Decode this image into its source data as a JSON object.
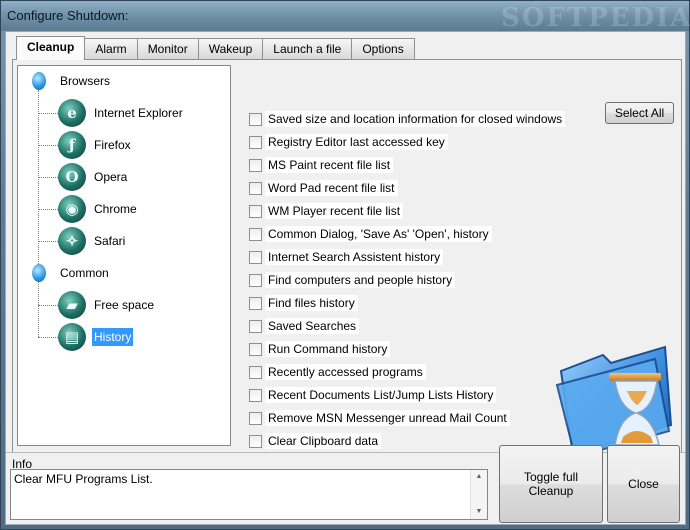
{
  "window": {
    "title": "Configure Shutdown:",
    "watermark": "SOFTPEDIA"
  },
  "tabs": [
    {
      "label": "Cleanup",
      "active": true
    },
    {
      "label": "Alarm",
      "active": false
    },
    {
      "label": "Monitor",
      "active": false
    },
    {
      "label": "Wakeup",
      "active": false
    },
    {
      "label": "Launch a file",
      "active": false
    },
    {
      "label": "Options",
      "active": false
    }
  ],
  "tree": {
    "groups": [
      {
        "label": "Browsers",
        "items": [
          {
            "label": "Internet Explorer",
            "icon": "internet-explorer-icon",
            "glyph": "e"
          },
          {
            "label": "Firefox",
            "icon": "firefox-icon",
            "glyph": "ƒ"
          },
          {
            "label": "Opera",
            "icon": "opera-icon",
            "glyph": "O"
          },
          {
            "label": "Chrome",
            "icon": "chrome-icon",
            "glyph": "◉"
          },
          {
            "label": "Safari",
            "icon": "safari-icon",
            "glyph": "✧"
          }
        ]
      },
      {
        "label": "Common",
        "items": [
          {
            "label": "Free space",
            "icon": "free-space-icon",
            "glyph": "▰"
          },
          {
            "label": "History",
            "icon": "history-icon",
            "glyph": "▤",
            "selected": true
          }
        ]
      }
    ]
  },
  "select_all_label": "Select All",
  "checklist": [
    "Saved size and location information for closed windows",
    "Registry Editor last accessed key",
    "MS Paint recent file list",
    "Word Pad recent file list",
    "WM Player recent file list",
    "Common Dialog, 'Save As' 'Open', history",
    "Internet Search Assistent history",
    "Find computers and people history",
    "Find files history",
    "Saved Searches",
    "Run Command history",
    "Recently accessed programs",
    "Recent Documents List/Jump Lists History",
    "Remove MSN Messenger unread Mail Count",
    "Clear Clipboard data"
  ],
  "info": {
    "label": "Info",
    "text": "Clear MFU Programs List."
  },
  "buttons": {
    "toggle": "Toggle full Cleanup",
    "close": "Close"
  },
  "colors": {
    "selection": "#3399ff",
    "folder": "#2f7fd6"
  }
}
